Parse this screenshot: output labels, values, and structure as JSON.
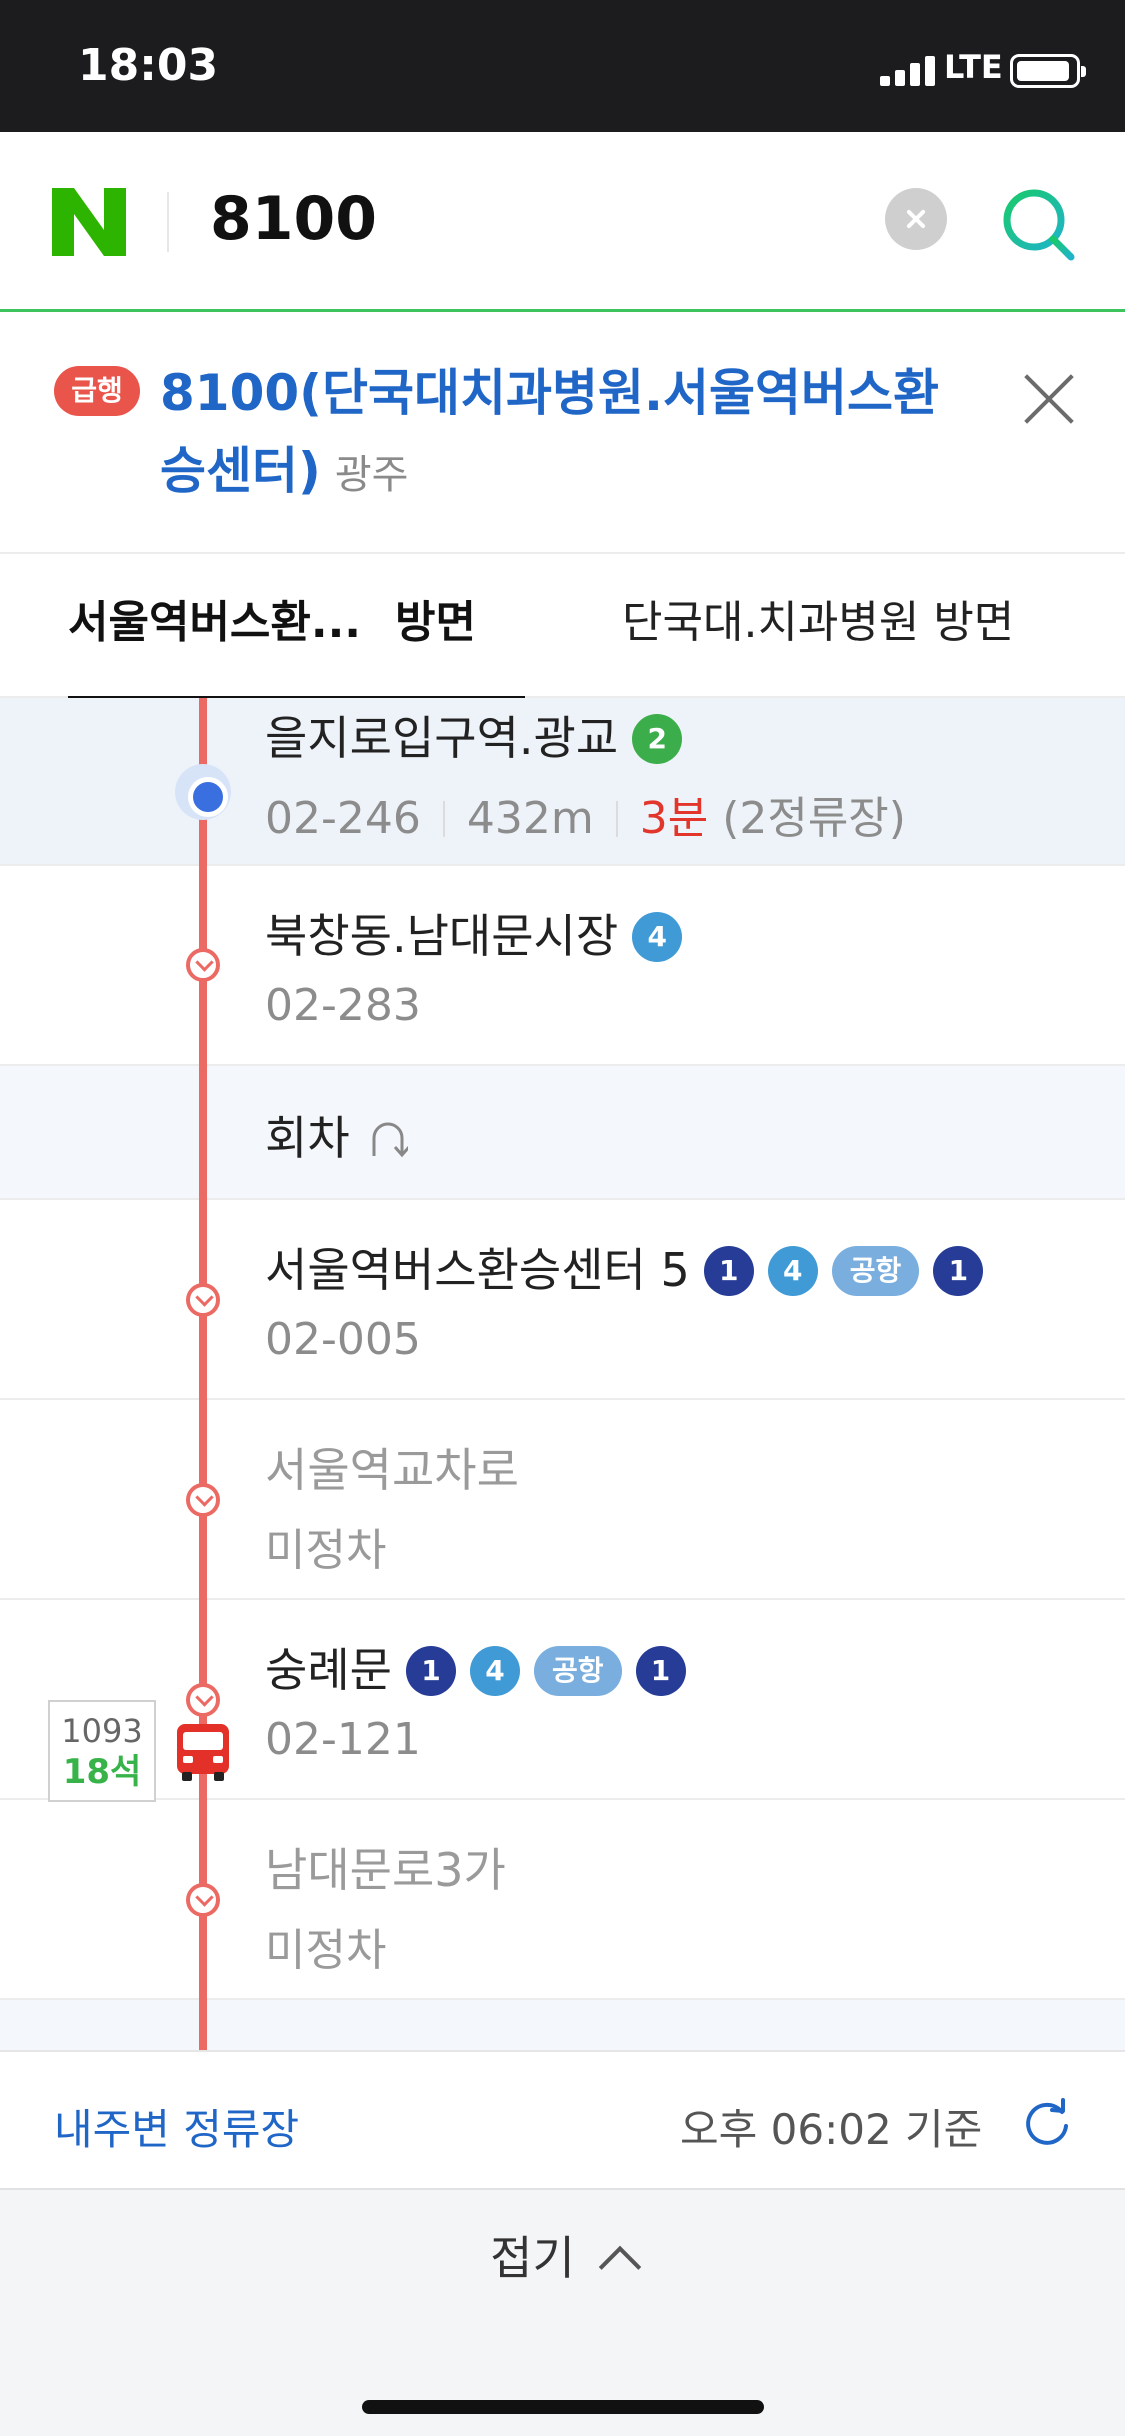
{
  "status_bar": {
    "time": "18:03",
    "network": "LTE"
  },
  "search": {
    "query": "8100"
  },
  "route": {
    "badge": "급행",
    "title": "8100(단국대치과병원.서울역버스환승센터)",
    "region": "광주"
  },
  "tabs": [
    {
      "label": "서울역버스환...",
      "suffix": "방면",
      "active": true
    },
    {
      "label": "단국대.치과병원 방면",
      "active": false
    }
  ],
  "stops": [
    {
      "name": "을지로입구역.광교",
      "lines": [
        "2"
      ],
      "id": "02-246",
      "distance": "432m",
      "eta": "3분",
      "eta_note": "(2정류장)",
      "current": true
    },
    {
      "name": "북창동.남대문시장",
      "lines": [
        "4"
      ],
      "id": "02-283"
    },
    {
      "name": "회차",
      "turnaround": true
    },
    {
      "name": "서울역버스환승센터 5",
      "lines": [
        "1",
        "4",
        "공항",
        "1"
      ],
      "id": "02-005"
    },
    {
      "name": "서울역교차로",
      "id": "미정차",
      "not_stopping": true
    },
    {
      "name": "숭례문",
      "lines": [
        "1",
        "4",
        "공항",
        "1"
      ],
      "id": "02-121"
    },
    {
      "name": "남대문로3가",
      "id": "미정차",
      "not_stopping": true
    }
  ],
  "bus": {
    "number": "1093",
    "seats": "18석"
  },
  "footer": {
    "nearby_label": "내주변 정류장",
    "updated": "오후 06:02 기준"
  },
  "collapse": {
    "label": "접기"
  },
  "colors": {
    "route_line": "#ec6a64",
    "link_blue": "#1f66c7",
    "naver_green": "#3ec45d",
    "eta_red": "#e2352b"
  },
  "icons": [
    "naver-logo-icon",
    "clear-icon",
    "search-icon",
    "close-icon",
    "current-location-icon",
    "stop-node-icon",
    "turnaround-icon",
    "bus-icon",
    "refresh-icon",
    "chevron-up-icon"
  ]
}
